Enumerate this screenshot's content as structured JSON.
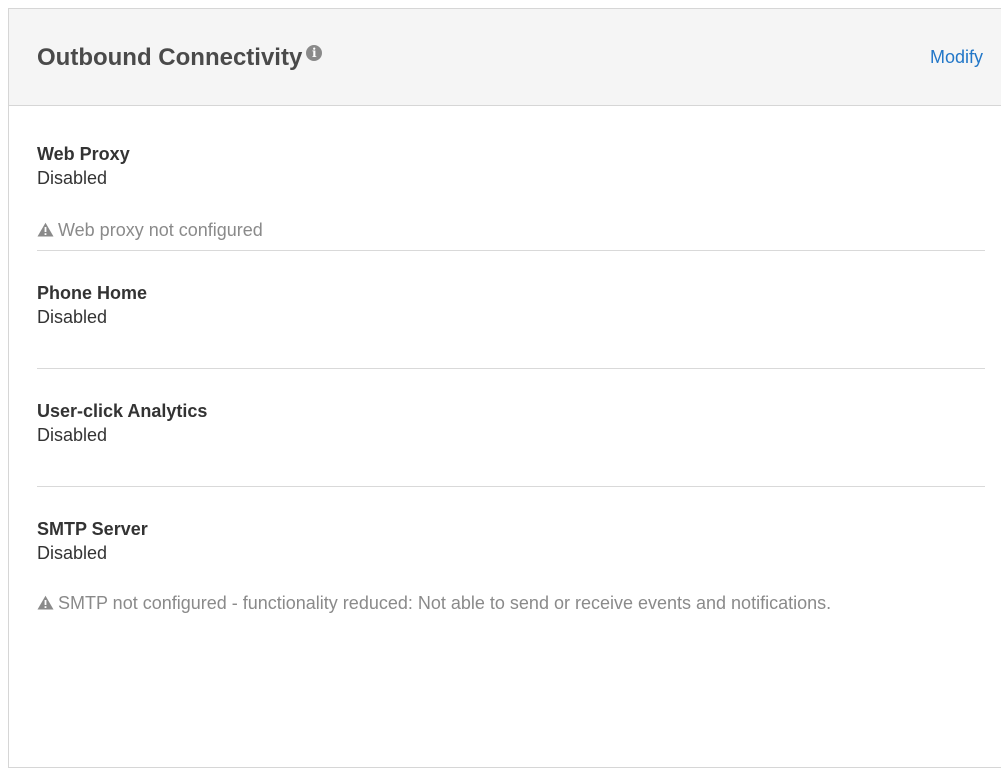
{
  "panel": {
    "title": "Outbound Connectivity",
    "info_icon": "info-icon",
    "modify_label": "Modify",
    "accent_color": "#2277c8"
  },
  "sections": [
    {
      "label": "Web Proxy",
      "value": "Disabled",
      "warning": "Web proxy not configured"
    },
    {
      "label": "Phone Home",
      "value": "Disabled"
    },
    {
      "label": "User-click Analytics",
      "value": "Disabled"
    },
    {
      "label": "SMTP Server",
      "value": "Disabled",
      "warning": "SMTP not configured - functionality reduced: Not able to send or receive events and notifications."
    }
  ]
}
